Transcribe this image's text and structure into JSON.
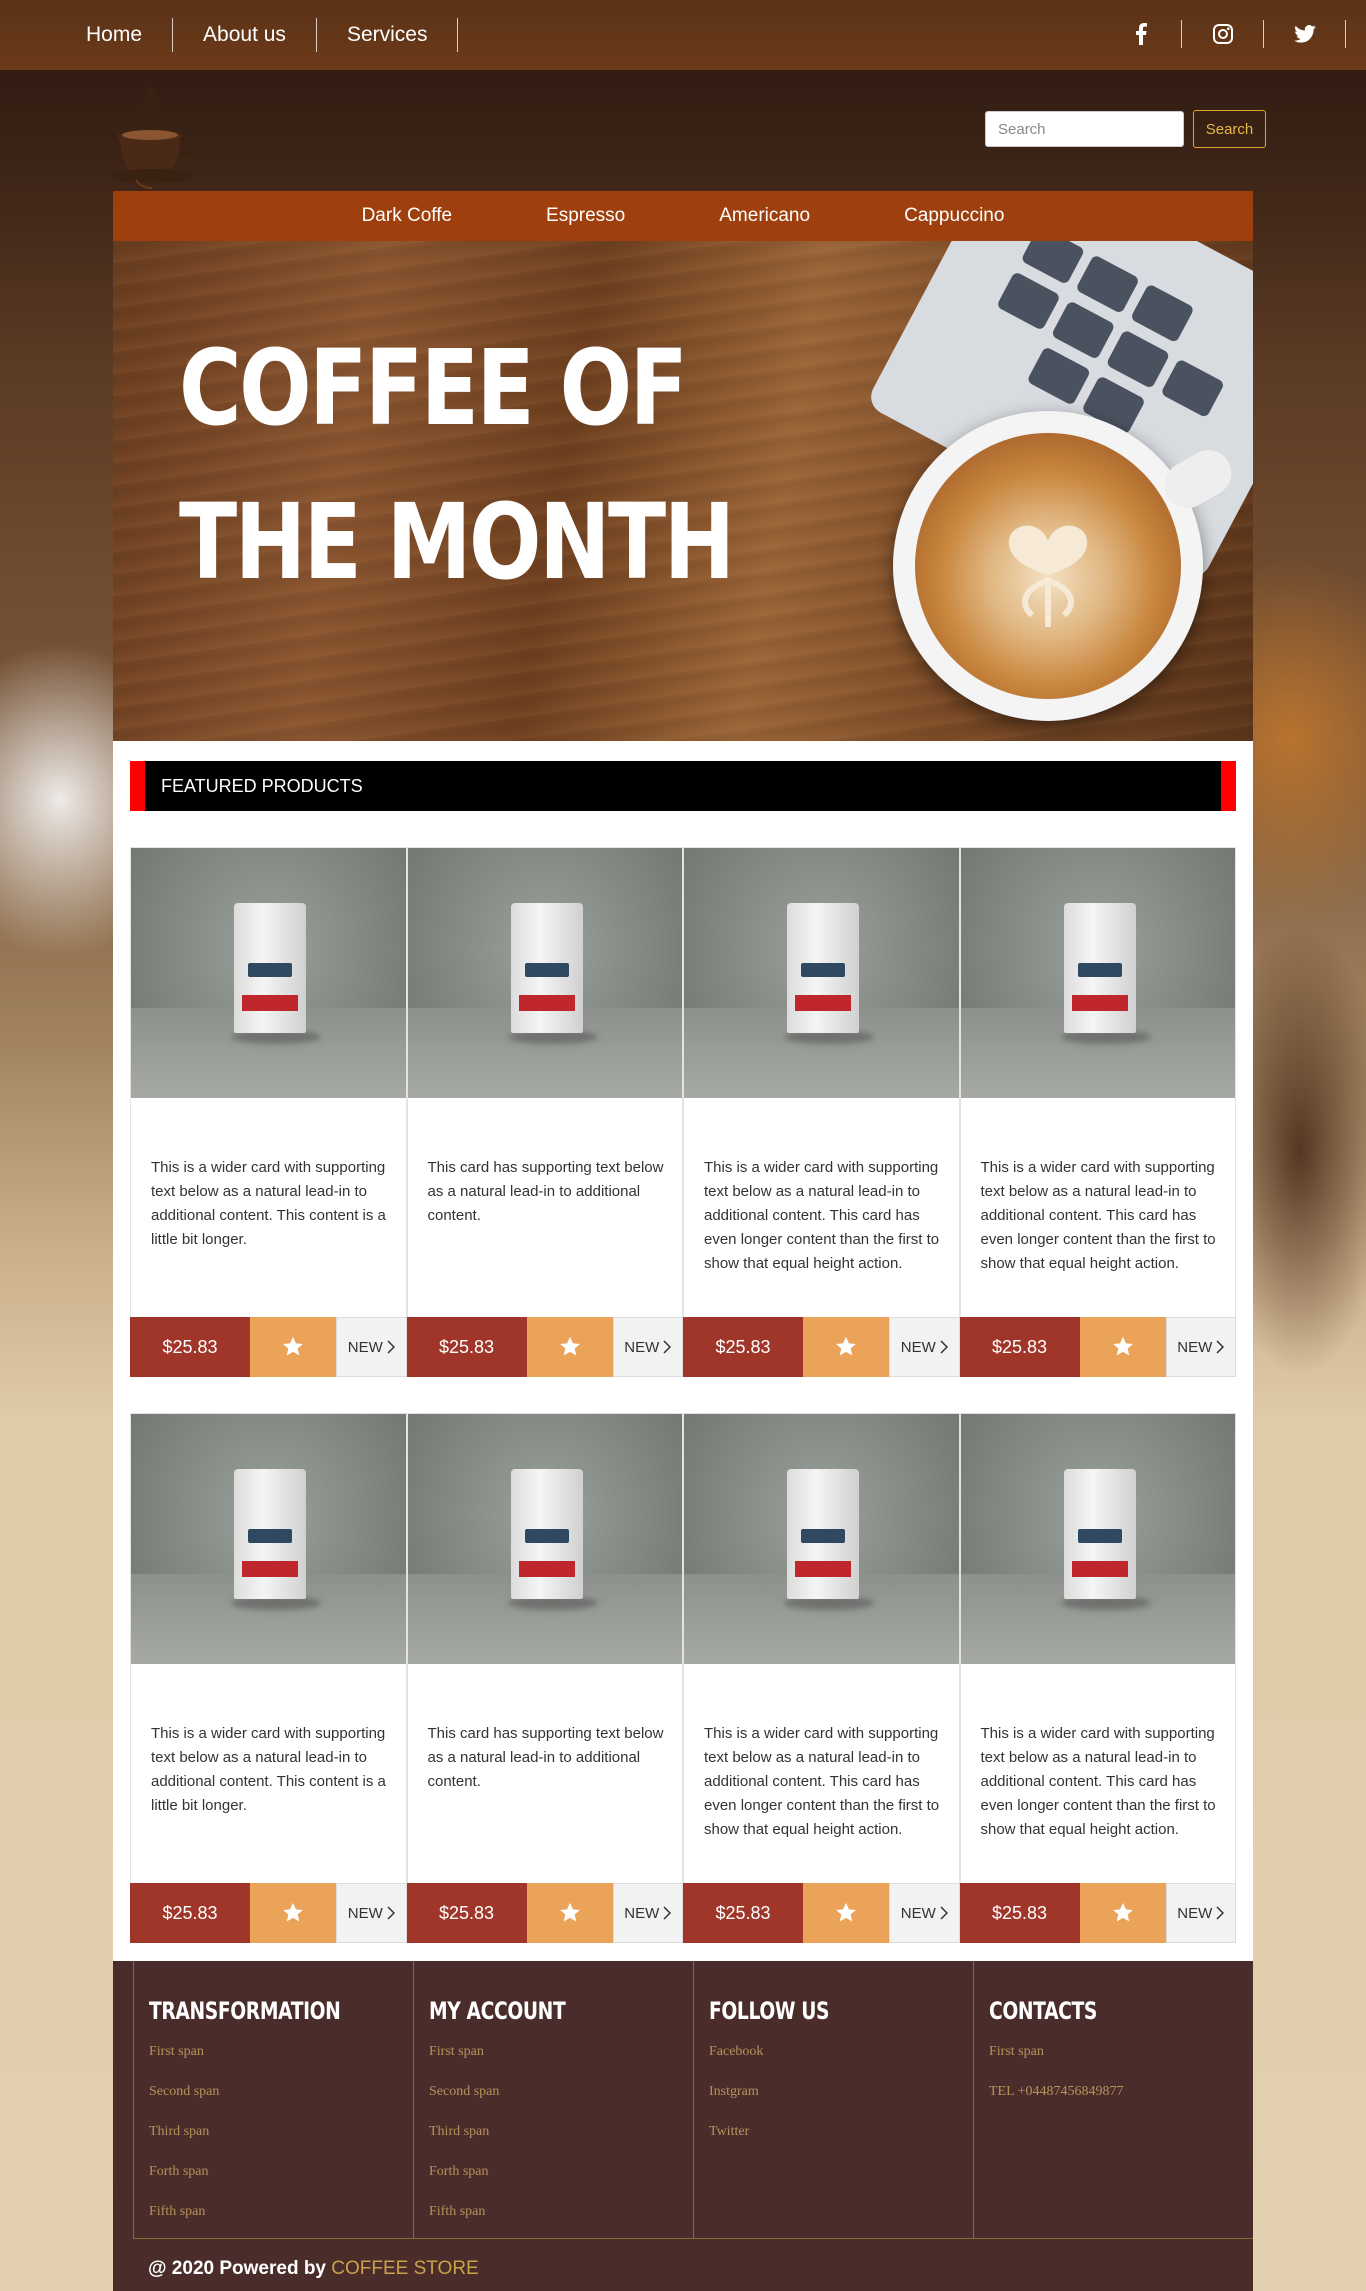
{
  "topnav": {
    "links": [
      "Home",
      "About us",
      "Services"
    ],
    "social": [
      "facebook-icon",
      "instagram-icon",
      "twitter-icon"
    ]
  },
  "search": {
    "placeholder": "Search",
    "button_label": "Search"
  },
  "category_nav": [
    "Dark Coffe",
    "Espresso",
    "Americano",
    "Cappuccino"
  ],
  "hero": {
    "title": "COFFEE OF THE MONTH"
  },
  "featured": {
    "heading": "FEATURED PRODUCTS"
  },
  "cards": [
    {
      "text": "This is a wider card with supporting text below as a natural lead-in to additional content. This content is a little bit longer.",
      "price": "$25.83",
      "tag": "NEW"
    },
    {
      "text": "This card has supporting text below as a natural lead-in to additional content.",
      "price": "$25.83",
      "tag": "NEW"
    },
    {
      "text": "This is a wider card with supporting text below as a natural lead-in to additional content. This card has even longer content than the first to show that equal height action.",
      "price": "$25.83",
      "tag": "NEW"
    },
    {
      "text": "This is a wider card with supporting text below as a natural lead-in to additional content. This card has even longer content than the first to show that equal height action.",
      "price": "$25.83",
      "tag": "NEW"
    },
    {
      "text": "This is a wider card with supporting text below as a natural lead-in to additional content. This content is a little bit longer.",
      "price": "$25.83",
      "tag": "NEW"
    },
    {
      "text": "This card has supporting text below as a natural lead-in to additional content.",
      "price": "$25.83",
      "tag": "NEW"
    },
    {
      "text": "This is a wider card with supporting text below as a natural lead-in to additional content. This card has even longer content than the first to show that equal height action.",
      "price": "$25.83",
      "tag": "NEW"
    },
    {
      "text": "This is a wider card with supporting text below as a natural lead-in to additional content. This card has even longer content than the first to show that equal height action.",
      "price": "$25.83",
      "tag": "NEW"
    }
  ],
  "footer": {
    "columns": [
      {
        "title": "TRANSFORMATION",
        "items": [
          "First span",
          "Second span",
          "Third span",
          "Forth span",
          "Fifth span"
        ]
      },
      {
        "title": "MY ACCOUNT",
        "items": [
          "First span",
          "Second span",
          "Third span",
          "Forth span",
          "Fifth span"
        ]
      },
      {
        "title": "FOLLOW US",
        "items": [
          "Facebook",
          "Instgram",
          "Twitter"
        ]
      },
      {
        "title": "CONTACTS",
        "items": [
          "First span",
          "TEL +04487456849877"
        ]
      }
    ],
    "copyright": "@ 2020 Powered by",
    "brand": "COFFEE STORE"
  },
  "colors": {
    "topnav": "#6b3a19",
    "category_nav": "#9e3f0d",
    "price": "#a0362a",
    "star": "#eba35a",
    "featured_accent": "#ff0000",
    "footer": "#4a2d2a",
    "brand": "#c9a24a"
  }
}
